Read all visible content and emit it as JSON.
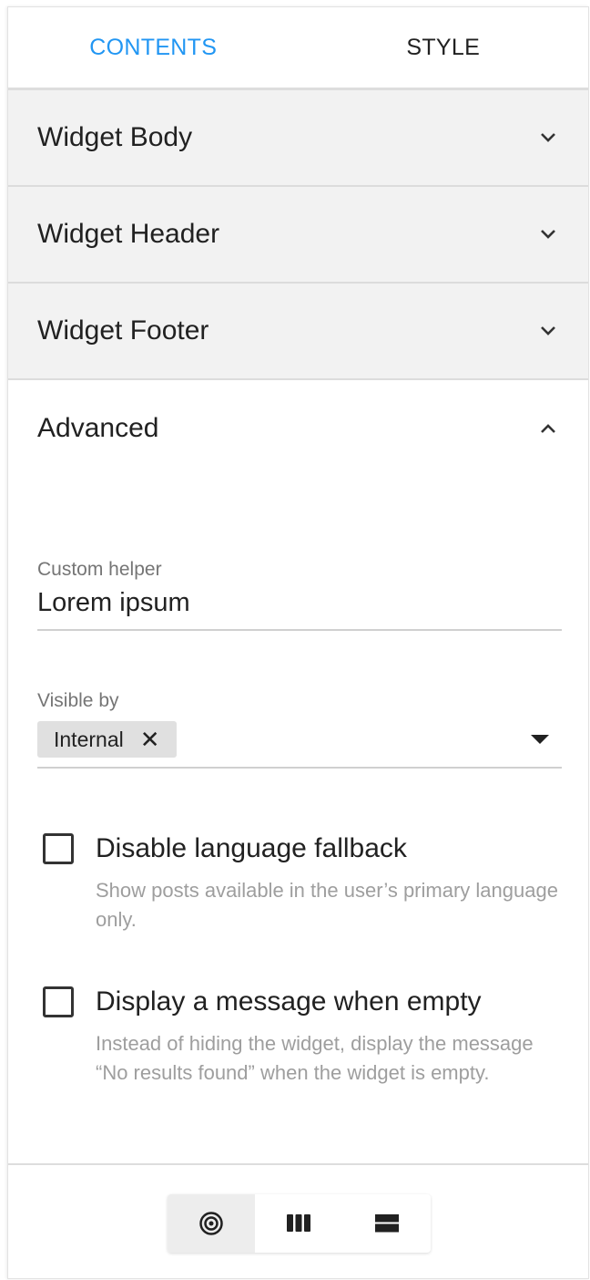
{
  "tabs": [
    {
      "label": "CONTENTS",
      "active": true
    },
    {
      "label": "STYLE",
      "active": false
    }
  ],
  "sections": [
    {
      "title": "Widget Body",
      "expanded": false
    },
    {
      "title": "Widget Header",
      "expanded": false
    },
    {
      "title": "Widget Footer",
      "expanded": false
    },
    {
      "title": "Advanced",
      "expanded": true
    }
  ],
  "advanced": {
    "custom_helper": {
      "label": "Custom helper",
      "value": "Lorem ipsum"
    },
    "visible_by": {
      "label": "Visible by",
      "chip": "Internal"
    },
    "checkboxes": [
      {
        "label": "Disable language fallback",
        "helper": "Show posts available in the user’s primary language only.",
        "checked": false
      },
      {
        "label": "Display a message when empty",
        "helper": "Instead of hiding the widget, display the message “No results found” when the widget is empty.",
        "checked": false
      }
    ]
  },
  "view_toggle": {
    "options": [
      "target-icon",
      "columns-icon",
      "rows-icon"
    ],
    "selected": 0
  },
  "colors": {
    "accent": "#2196f3"
  }
}
